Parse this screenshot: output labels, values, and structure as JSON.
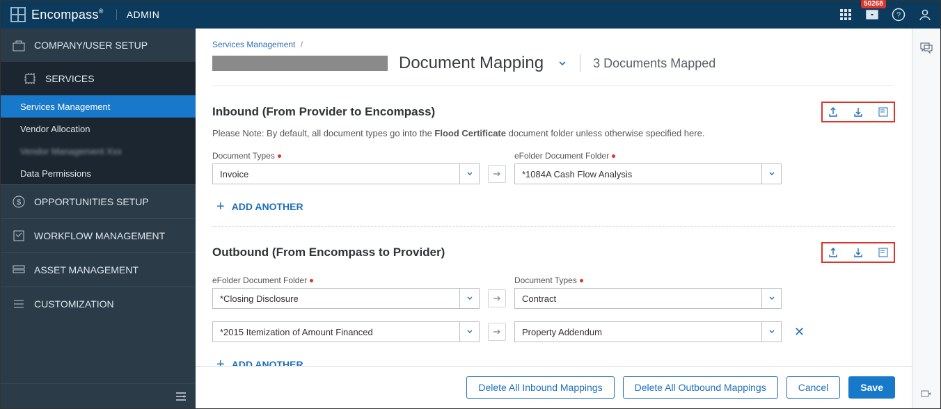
{
  "topbar": {
    "brand": "Encompass",
    "brand_mark": "®",
    "admin_label": "ADMIN",
    "inbox_count": "50268"
  },
  "sidebar": {
    "sections": [
      {
        "label": "COMPANY/USER SETUP",
        "icon": "company-icon"
      },
      {
        "label": "SERVICES",
        "icon": "services-icon",
        "expanded": true,
        "items": [
          {
            "label": "Services Management",
            "active": true
          },
          {
            "label": "Vendor Allocation"
          },
          {
            "label": "redacted",
            "blurred": true
          },
          {
            "label": "Data Permissions"
          }
        ]
      },
      {
        "label": "OPPORTUNITIES SETUP",
        "icon": "opportunities-icon"
      },
      {
        "label": "WORKFLOW MANAGEMENT",
        "icon": "workflow-icon"
      },
      {
        "label": "ASSET MANAGEMENT",
        "icon": "asset-icon"
      },
      {
        "label": "CUSTOMIZATION",
        "icon": "customization-icon"
      }
    ]
  },
  "breadcrumb": {
    "parent": "Services Management",
    "sep": "/"
  },
  "header": {
    "title": "Document Mapping",
    "count_text": "Documents Mapped",
    "count_number": "3"
  },
  "sections": {
    "inbound": {
      "title": "Inbound (From Provider to Encompass)",
      "note_pre": "Please Note: By default, all document types go into the ",
      "note_bold": "Flood Certificate",
      "note_post": " document folder unless otherwise specified here.",
      "left_label": "Document Types",
      "right_label": "eFolder Document Folder",
      "rows": [
        {
          "left": "Invoice",
          "right": "*1084A Cash Flow Analysis"
        }
      ],
      "add_label": "ADD ANOTHER"
    },
    "outbound": {
      "title": "Outbound (From Encompass to Provider)",
      "left_label": "eFolder Document Folder",
      "right_label": "Document Types",
      "rows": [
        {
          "left": "*Closing Disclosure",
          "right": "Contract"
        },
        {
          "left": "*2015 Itemization of Amount Financed",
          "right": "Property Addendum",
          "removable": true
        }
      ],
      "add_label": "ADD ANOTHER"
    }
  },
  "footer": {
    "delete_inbound": "Delete All Inbound Mappings",
    "delete_outbound": "Delete All Outbound Mappings",
    "cancel": "Cancel",
    "save": "Save"
  }
}
